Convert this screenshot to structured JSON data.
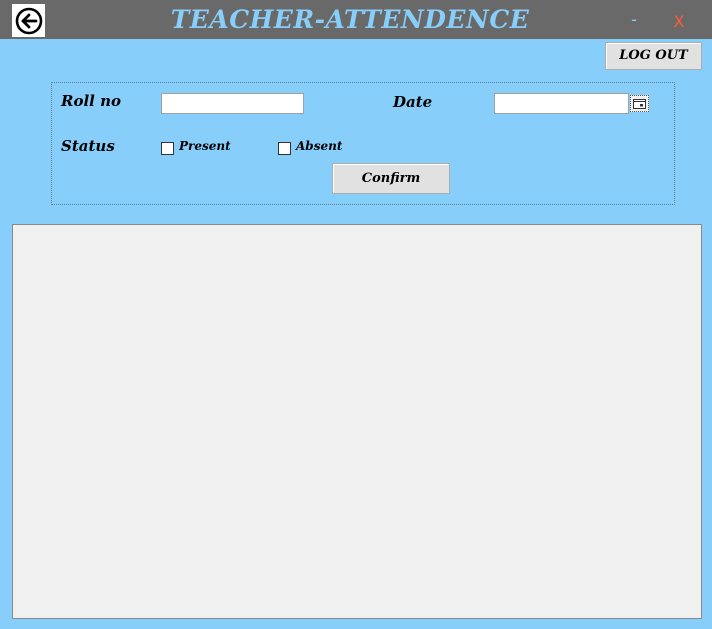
{
  "window": {
    "title": "TEACHER-ATTENDENCE",
    "minimize_label": "-",
    "close_label": "X"
  },
  "toolbar": {
    "logout_label": "LOG OUT"
  },
  "form": {
    "roll_label": "Roll no",
    "roll_value": "",
    "date_label": "Date",
    "date_value": "",
    "status_label": "Status",
    "present_label": "Present",
    "present_checked": false,
    "absent_label": "Absent",
    "absent_checked": false,
    "confirm_label": "Confirm"
  },
  "icons": {
    "back": "arrow-left-circle-icon",
    "calendar": "calendar-icon"
  },
  "colors": {
    "background": "#87cefa",
    "titlebar": "#696969",
    "title_text": "#87cefa",
    "close": "#ff5a3c",
    "grid": "#f0f0f0"
  }
}
